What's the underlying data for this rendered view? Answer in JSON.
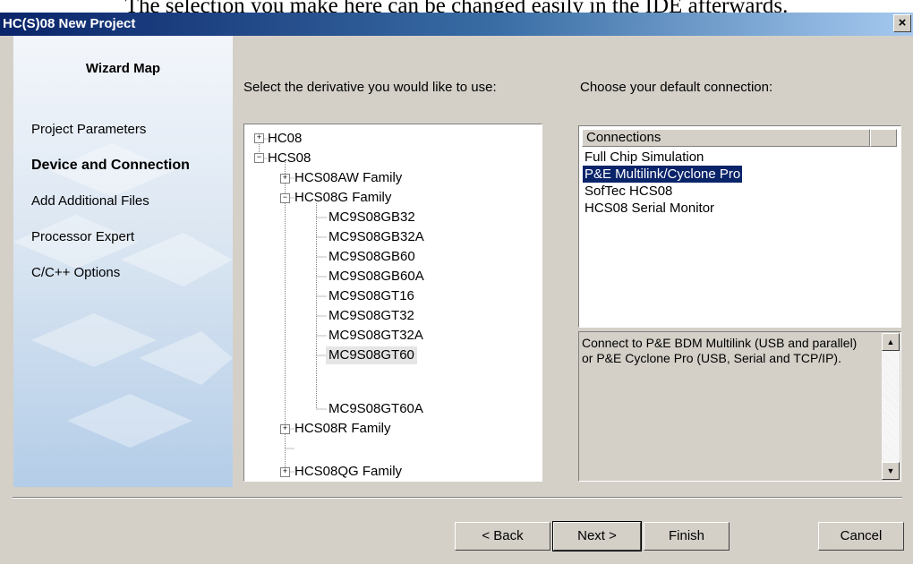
{
  "doc_text": "The selection you make here can be changed easily in the IDE afterwards.",
  "window": {
    "title": "HC(S)08 New Project",
    "close_label": "×"
  },
  "wizard_map": {
    "title": "Wizard Map",
    "items": [
      {
        "label": "Project Parameters",
        "active": false
      },
      {
        "label": "Device and Connection",
        "active": true
      },
      {
        "label": "Add Additional Files",
        "active": false
      },
      {
        "label": "Processor Expert",
        "active": false
      },
      {
        "label": "C/C++ Options",
        "active": false
      }
    ]
  },
  "derivative_prompt": "Select the derivative you would like to use:",
  "connection_prompt": "Choose your default connection:",
  "tree": {
    "nodes": [
      {
        "label": "HC08",
        "level": 0,
        "expander": "+"
      },
      {
        "label": "HCS08",
        "level": 0,
        "expander": "−"
      },
      {
        "label": "HCS08AW Family",
        "level": 1,
        "expander": "+"
      },
      {
        "label": "HCS08G Family",
        "level": 1,
        "expander": "−"
      },
      {
        "label": "MC9S08GB32",
        "level": 2,
        "expander": ""
      },
      {
        "label": "MC9S08GB32A",
        "level": 2,
        "expander": ""
      },
      {
        "label": "MC9S08GB60",
        "level": 2,
        "expander": ""
      },
      {
        "label": "MC9S08GB60A",
        "level": 2,
        "expander": ""
      },
      {
        "label": "MC9S08GT16",
        "level": 2,
        "expander": ""
      },
      {
        "label": "MC9S08GT32",
        "level": 2,
        "expander": ""
      },
      {
        "label": "MC9S08GT32A",
        "level": 2,
        "expander": ""
      },
      {
        "label": "MC9S08GT60",
        "level": 2,
        "expander": "",
        "selected": true
      },
      {
        "label": "MC9S08GT60A",
        "level": 2,
        "expander": ""
      },
      {
        "label": "HCS08R Family",
        "level": 1,
        "expander": "+"
      },
      {
        "label": "HCS08QG Family",
        "level": 1,
        "expander": "+"
      }
    ]
  },
  "connections": {
    "header": "Connections",
    "items": [
      {
        "label": "Full Chip Simulation",
        "selected": false
      },
      {
        "label": "P&E Multilink/Cyclone Pro",
        "selected": true
      },
      {
        "label": "SofTec HCS08",
        "selected": false
      },
      {
        "label": "HCS08 Serial Monitor",
        "selected": false
      }
    ]
  },
  "description": "Connect to P&E BDM Multilink (USB and parallel) or P&E Cyclone Pro (USB, Serial and TCP/IP).",
  "scroll": {
    "up": "▲",
    "down": "▼"
  },
  "buttons": {
    "back": "< Back",
    "next": "Next >",
    "finish": "Finish",
    "cancel": "Cancel"
  },
  "colors": {
    "title_start": "#0a246a",
    "title_end": "#a6caf0",
    "selection": "#0a246a",
    "face": "#d4d0c8"
  }
}
